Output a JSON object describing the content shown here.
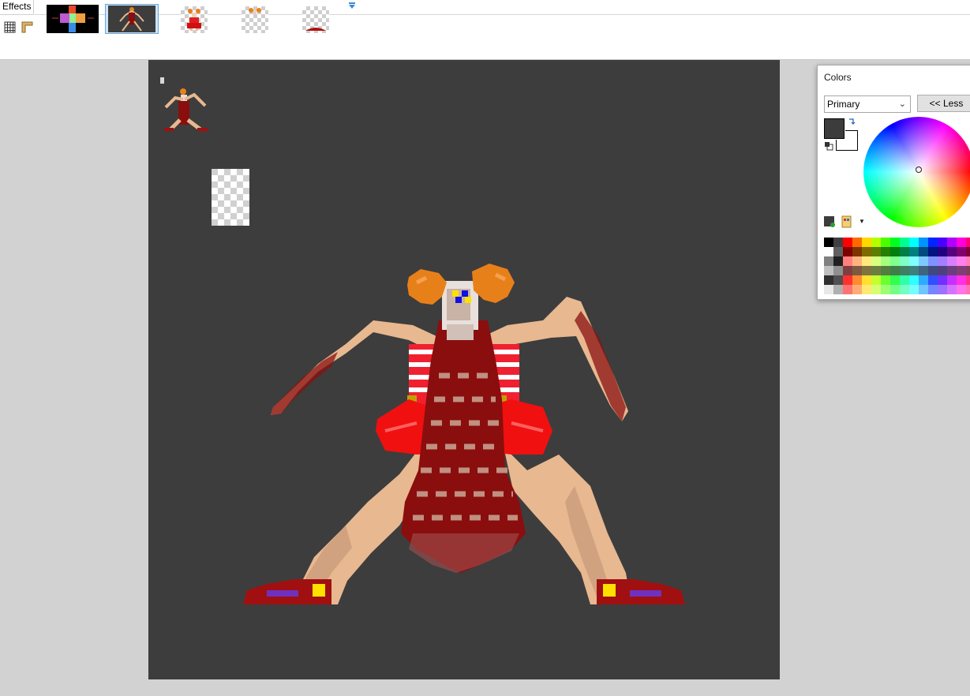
{
  "toolbar": {
    "effects_label": "Effects",
    "tools": [
      {
        "icon": "grid-icon"
      },
      {
        "icon": "ruler-icon"
      }
    ],
    "more_icon": "chevron-down-icon"
  },
  "image_tabs": [
    {
      "name": "image-tab-1",
      "kind": "color-cross",
      "active": false
    },
    {
      "name": "image-tab-2",
      "kind": "sprite",
      "active": true
    },
    {
      "name": "image-tab-3",
      "kind": "transparent-sprite",
      "active": false
    },
    {
      "name": "image-tab-4",
      "kind": "transparent-sprite",
      "active": false
    },
    {
      "name": "image-tab-5",
      "kind": "transparent-sprite",
      "active": false
    }
  ],
  "canvas": {
    "background": "#3d3d3d",
    "workspace_bg": "#d2d2d2"
  },
  "colors_panel": {
    "title": "Colors",
    "mode_selected": "Primary",
    "less_button": "<< Less",
    "primary_color": "#3c3c3c",
    "secondary_color": "#ffffff",
    "icons": [
      "swap-colors-icon",
      "reset-colors-icon",
      "add-to-palette-icon",
      "palette-menu-icon"
    ]
  }
}
